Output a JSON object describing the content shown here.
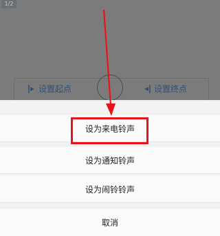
{
  "top_badge": "1/2",
  "controls": {
    "set_start_label": "设置起点",
    "set_end_label": "设置终点"
  },
  "sheet": {
    "options": [
      {
        "label": "设为来电铃声"
      },
      {
        "label": "设为通知铃声"
      },
      {
        "label": "设为闹铃铃声"
      }
    ],
    "cancel_label": "取消"
  },
  "icons": {
    "start": "set-start-icon",
    "end": "set-end-icon",
    "play": "circle-play-icon",
    "arrow": "annotation-arrow-icon"
  },
  "colors": {
    "highlight": "#e8141b",
    "control_text": "#2f4f7a"
  }
}
